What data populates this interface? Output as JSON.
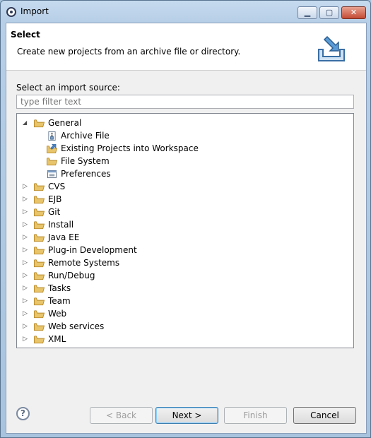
{
  "window": {
    "title": "Import",
    "controls": [
      "minimize",
      "maximize",
      "close"
    ]
  },
  "banner": {
    "title": "Select",
    "description": "Create new projects from an archive file or directory.",
    "icon": "import-wizard-icon"
  },
  "source_label": "Select an import source:",
  "filter": {
    "placeholder": "type filter text",
    "value": ""
  },
  "tree": {
    "items": [
      {
        "label": "General",
        "icon": "folder-icon",
        "expanded": true,
        "level": 0
      },
      {
        "label": "Archive File",
        "icon": "archive-file-icon",
        "level": 1
      },
      {
        "label": "Existing Projects into Workspace",
        "icon": "existing-projects-icon",
        "level": 1,
        "selected": true
      },
      {
        "label": "File System",
        "icon": "folder-icon",
        "level": 1
      },
      {
        "label": "Preferences",
        "icon": "preferences-icon",
        "level": 1
      },
      {
        "label": "CVS",
        "icon": "folder-icon",
        "level": 0
      },
      {
        "label": "EJB",
        "icon": "folder-icon",
        "level": 0
      },
      {
        "label": "Git",
        "icon": "folder-icon",
        "level": 0
      },
      {
        "label": "Install",
        "icon": "folder-icon",
        "level": 0
      },
      {
        "label": "Java EE",
        "icon": "folder-icon",
        "level": 0
      },
      {
        "label": "Plug-in Development",
        "icon": "folder-icon",
        "level": 0
      },
      {
        "label": "Remote Systems",
        "icon": "folder-icon",
        "level": 0
      },
      {
        "label": "Run/Debug",
        "icon": "folder-icon",
        "level": 0
      },
      {
        "label": "Tasks",
        "icon": "folder-icon",
        "level": 0
      },
      {
        "label": "Team",
        "icon": "folder-icon",
        "level": 0
      },
      {
        "label": "Web",
        "icon": "folder-icon",
        "level": 0
      },
      {
        "label": "Web services",
        "icon": "folder-icon",
        "level": 0
      },
      {
        "label": "XML",
        "icon": "folder-icon",
        "level": 0
      }
    ]
  },
  "buttons": {
    "help": "?",
    "back": "< Back",
    "next": "Next >",
    "finish": "Finish",
    "cancel": "Cancel"
  },
  "colors": {
    "folder": "#e8c46a",
    "folder_edge": "#b98b2c",
    "accent": "#3c7fb1"
  }
}
